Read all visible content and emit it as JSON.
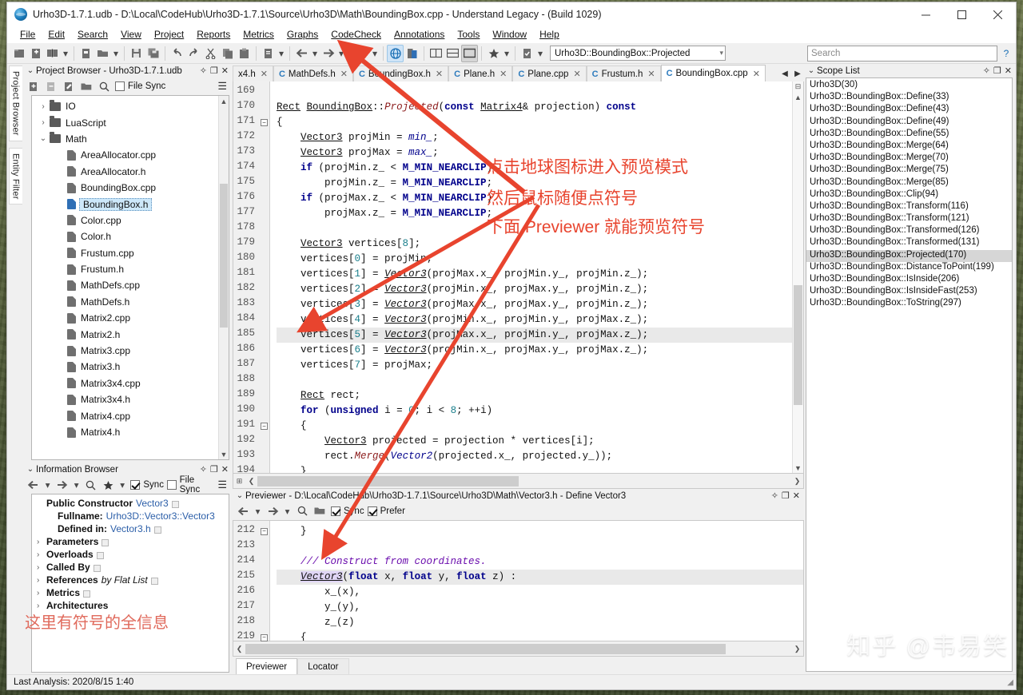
{
  "window": {
    "title": "Urho3D-1.7.1.udb - D:\\Local\\CodeHub\\Urho3D-1.7.1\\Source\\Urho3D\\Math\\BoundingBox.cpp - Understand Legacy - (Build 1029)",
    "minimize": "─",
    "maximize": "□",
    "close": "✕"
  },
  "menubar": {
    "items": [
      "File",
      "Edit",
      "Search",
      "View",
      "Project",
      "Reports",
      "Metrics",
      "Graphs",
      "CodeCheck",
      "Annotations",
      "Tools",
      "Window",
      "Help"
    ]
  },
  "toolbar": {
    "scope_combo_value": "Urho3D::BoundingBox::Projected",
    "search_placeholder": "Search",
    "help_label": "?",
    "icons": [
      "new-project-icon",
      "add-file-icon",
      "open-book-icon",
      "dropdown-arrow",
      "save-project-icon",
      "open-folder-icon",
      "dropdown-arrow",
      "save-icon",
      "save-all-icon",
      "undo-icon",
      "redo-icon",
      "cut-icon",
      "copy-icon",
      "paste-icon",
      "report-icon",
      "dropdown-arrow",
      "back-arrow-icon",
      "dropdown-arrow",
      "forward-arrow-icon",
      "dropdown-arrow",
      "graph-icon",
      "dropdown-arrow",
      "globe-icon",
      "compare-icon",
      "split-vertical-icon",
      "split-horizontal-icon",
      "single-pane-icon",
      "favorite-star-icon",
      "dropdown-arrow",
      "checklist-icon",
      "dropdown-arrow"
    ]
  },
  "vertical_tabs": [
    "Project Browser",
    "Entity Filter"
  ],
  "project_browser": {
    "title": "Project Browser - Urho3D-1.7.1.udb",
    "file_sync_label": "File Sync",
    "file_sync_checked": false,
    "tools": [
      "add-file-icon",
      "remove-file-icon",
      "edit-file-icon",
      "open-folder-icon",
      "search-icon"
    ],
    "tree": [
      {
        "label": "IO",
        "type": "folder",
        "expander": "›",
        "indent": 1,
        "selected": false
      },
      {
        "label": "LuaScript",
        "type": "folder",
        "expander": "›",
        "indent": 1,
        "selected": false
      },
      {
        "label": "Math",
        "type": "folder",
        "expander": "⌄",
        "indent": 1,
        "selected": false
      },
      {
        "label": "AreaAllocator.cpp",
        "type": "file",
        "expander": "",
        "indent": 2,
        "selected": false
      },
      {
        "label": "AreaAllocator.h",
        "type": "file",
        "expander": "",
        "indent": 2,
        "selected": false
      },
      {
        "label": "BoundingBox.cpp",
        "type": "file",
        "expander": "",
        "indent": 2,
        "selected": false
      },
      {
        "label": "BoundingBox.h",
        "type": "file",
        "expander": "",
        "indent": 2,
        "selected": true
      },
      {
        "label": "Color.cpp",
        "type": "file",
        "expander": "",
        "indent": 2,
        "selected": false
      },
      {
        "label": "Color.h",
        "type": "file",
        "expander": "",
        "indent": 2,
        "selected": false
      },
      {
        "label": "Frustum.cpp",
        "type": "file",
        "expander": "",
        "indent": 2,
        "selected": false
      },
      {
        "label": "Frustum.h",
        "type": "file",
        "expander": "",
        "indent": 2,
        "selected": false
      },
      {
        "label": "MathDefs.cpp",
        "type": "file",
        "expander": "",
        "indent": 2,
        "selected": false
      },
      {
        "label": "MathDefs.h",
        "type": "file",
        "expander": "",
        "indent": 2,
        "selected": false
      },
      {
        "label": "Matrix2.cpp",
        "type": "file",
        "expander": "",
        "indent": 2,
        "selected": false
      },
      {
        "label": "Matrix2.h",
        "type": "file",
        "expander": "",
        "indent": 2,
        "selected": false
      },
      {
        "label": "Matrix3.cpp",
        "type": "file",
        "expander": "",
        "indent": 2,
        "selected": false
      },
      {
        "label": "Matrix3.h",
        "type": "file",
        "expander": "",
        "indent": 2,
        "selected": false
      },
      {
        "label": "Matrix3x4.cpp",
        "type": "file",
        "expander": "",
        "indent": 2,
        "selected": false
      },
      {
        "label": "Matrix3x4.h",
        "type": "file",
        "expander": "",
        "indent": 2,
        "selected": false
      },
      {
        "label": "Matrix4.cpp",
        "type": "file",
        "expander": "",
        "indent": 2,
        "selected": false
      },
      {
        "label": "Matrix4.h",
        "type": "file",
        "expander": "",
        "indent": 2,
        "selected": false
      }
    ]
  },
  "information_browser": {
    "title": "Information Browser",
    "sync_label": "Sync",
    "sync_checked": true,
    "file_sync_label": "File Sync",
    "file_sync_checked": false,
    "rows": [
      {
        "twisty": "",
        "label": "Public Constructor",
        "value": "Vector3",
        "italic": "",
        "badge": true
      },
      {
        "twisty": "",
        "label": "Fullname:",
        "value": "Urho3D::Vector3::Vector3",
        "italic": "",
        "badge": false,
        "indent": 1
      },
      {
        "twisty": "",
        "label": "Defined in:",
        "value": "Vector3.h",
        "italic": "",
        "badge": true,
        "indent": 1
      },
      {
        "twisty": "›",
        "label": "Parameters",
        "value": "",
        "italic": "",
        "badge": true
      },
      {
        "twisty": "›",
        "label": "Overloads",
        "value": "",
        "italic": "",
        "badge": true
      },
      {
        "twisty": "›",
        "label": "Called By",
        "value": "",
        "italic": "",
        "badge": true
      },
      {
        "twisty": "›",
        "label": "References",
        "value": "",
        "italic": "by Flat List",
        "badge": true
      },
      {
        "twisty": "›",
        "label": "Metrics",
        "value": "",
        "italic": "",
        "badge": true
      },
      {
        "twisty": "›",
        "label": "Architectures",
        "value": "",
        "italic": "",
        "badge": false
      }
    ]
  },
  "editor": {
    "tabs": [
      {
        "label": "x4.h",
        "active": false,
        "partial": true
      },
      {
        "label": "MathDefs.h",
        "active": false
      },
      {
        "label": "BoundingBox.h",
        "active": false
      },
      {
        "label": "Plane.h",
        "active": false
      },
      {
        "label": "Plane.cpp",
        "active": false
      },
      {
        "label": "Frustum.h",
        "active": false
      },
      {
        "label": "BoundingBox.cpp",
        "active": true
      }
    ],
    "first_line": 169,
    "highlight_line": 185,
    "fold_lines": [
      171,
      191
    ],
    "lines": [
      "",
      "Rect BoundingBox::Projected(const Matrix4& projection) const",
      "{",
      "    Vector3 projMin = min_;",
      "    Vector3 projMax = max_;",
      "    if (projMin.z_ < M_MIN_NEARCLIP)",
      "        projMin.z_ = M_MIN_NEARCLIP;",
      "    if (projMax.z_ < M_MIN_NEARCLIP)",
      "        projMax.z_ = M_MIN_NEARCLIP;",
      "",
      "    Vector3 vertices[8];",
      "    vertices[0] = projMin;",
      "    vertices[1] = Vector3(projMax.x_, projMin.y_, projMin.z_);",
      "    vertices[2] = Vector3(projMin.x_, projMax.y_, projMin.z_);",
      "    vertices[3] = Vector3(projMax.x_, projMax.y_, projMin.z_);",
      "    vertices[4] = Vector3(projMin.x_, projMin.y_, projMax.z_);",
      "    vertices[5] = Vector3(projMax.x_, projMin.y_, projMax.z_);",
      "    vertices[6] = Vector3(projMin.x_, projMax.y_, projMax.z_);",
      "    vertices[7] = projMax;",
      "",
      "    Rect rect;",
      "    for (unsigned i = 0; i < 8; ++i)",
      "    {",
      "        Vector3 projected = projection * vertices[i];",
      "        rect.Merge(Vector2(projected.x_, projected.y_));",
      "    }"
    ]
  },
  "scope_list": {
    "title": "Scope List",
    "items": [
      {
        "label": "Urho3D(30)",
        "selected": false
      },
      {
        "label": "Urho3D::BoundingBox::Define(33)",
        "selected": false
      },
      {
        "label": "Urho3D::BoundingBox::Define(43)",
        "selected": false
      },
      {
        "label": "Urho3D::BoundingBox::Define(49)",
        "selected": false
      },
      {
        "label": "Urho3D::BoundingBox::Define(55)",
        "selected": false
      },
      {
        "label": "Urho3D::BoundingBox::Merge(64)",
        "selected": false
      },
      {
        "label": "Urho3D::BoundingBox::Merge(70)",
        "selected": false
      },
      {
        "label": "Urho3D::BoundingBox::Merge(75)",
        "selected": false
      },
      {
        "label": "Urho3D::BoundingBox::Merge(85)",
        "selected": false
      },
      {
        "label": "Urho3D::BoundingBox::Clip(94)",
        "selected": false
      },
      {
        "label": "Urho3D::BoundingBox::Transform(116)",
        "selected": false
      },
      {
        "label": "Urho3D::BoundingBox::Transform(121)",
        "selected": false
      },
      {
        "label": "Urho3D::BoundingBox::Transformed(126)",
        "selected": false
      },
      {
        "label": "Urho3D::BoundingBox::Transformed(131)",
        "selected": false
      },
      {
        "label": "Urho3D::BoundingBox::Projected(170)",
        "selected": true
      },
      {
        "label": "Urho3D::BoundingBox::DistanceToPoint(199)",
        "selected": false
      },
      {
        "label": "Urho3D::BoundingBox::IsInside(206)",
        "selected": false
      },
      {
        "label": "Urho3D::BoundingBox::IsInsideFast(253)",
        "selected": false
      },
      {
        "label": "Urho3D::BoundingBox::ToString(297)",
        "selected": false
      }
    ]
  },
  "previewer": {
    "title": "Previewer - D:\\Local\\CodeHub\\Urho3D-1.7.1\\Source\\Urho3D\\Math\\Vector3.h - Define Vector3",
    "sync_label": "Sync",
    "sync_checked": true,
    "prefer_label": "Prefer",
    "prefer_checked": true,
    "first_line": 212,
    "highlight_line": 215,
    "fold_lines": [
      212,
      219
    ],
    "lines": [
      "    }",
      "",
      "    /// Construct from coordinates.",
      "    Vector3(float x, float y, float z) :",
      "        x_(x),",
      "        y_(y),",
      "        z_(z)",
      "    {"
    ],
    "tabs": [
      {
        "label": "Previewer",
        "active": true
      },
      {
        "label": "Locator",
        "active": false
      }
    ]
  },
  "statusbar": {
    "text": "Last Analysis: 2020/8/15 1:40"
  },
  "annotations": {
    "accent_color": "#e8442e",
    "lines": [
      "点击地球图标进入预览模式",
      "然后鼠标随便点符号",
      "下面 Previewer 就能预览符号"
    ],
    "info_note": "这里有符号的全信息",
    "watermark": "知乎 @韦易笑"
  }
}
